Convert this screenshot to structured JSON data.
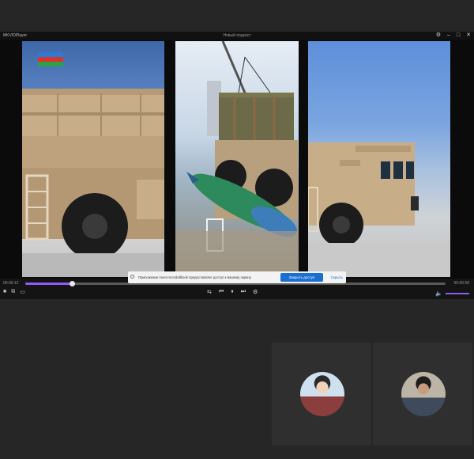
{
  "player": {
    "app_name": "MKVIDPlayer",
    "window_title": "Новый подкаст",
    "window_buttons": [
      "⚙",
      "–",
      "□",
      "✕"
    ],
    "time_elapsed": "00:00:12",
    "time_total": "00:00:58",
    "progress": 0.11,
    "volume": 1.0,
    "left_controls": [
      "■",
      "⧉",
      "▭"
    ],
    "center_controls": [
      "⇆",
      "⏮",
      "⏸",
      "⏭",
      "⚙"
    ],
    "volume_icon": "🔈"
  },
  "video": {
    "panels": [
      "desert-rocket-launcher-truck",
      "crane-loading-missile",
      "launcher-truck-front"
    ],
    "flag_colors": [
      "#2e7bd6",
      "#d9342b",
      "#2f9f4a"
    ]
  },
  "notice": {
    "text": "Приложение meet.recordallbook предоставляет доступ к вашему экрану",
    "share_button": "Закрыть доступ",
    "hide_button": "Скрыть"
  },
  "participants": [
    {
      "id": "participant-1"
    },
    {
      "id": "participant-2"
    }
  ],
  "colors": {
    "accent": "#8b5cf6",
    "share_blue": "#1a6fd1",
    "background": "#262626"
  }
}
